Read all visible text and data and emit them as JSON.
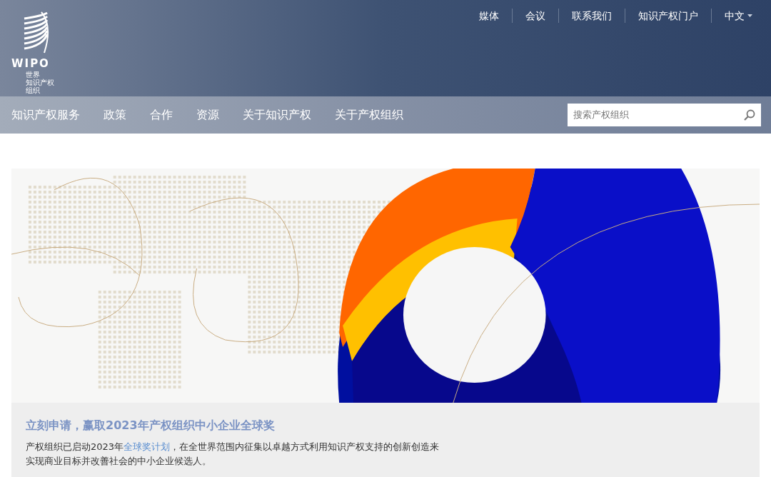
{
  "logo": {
    "wordmark": "WIPO",
    "lines": [
      "世界",
      "知识产权",
      "组织"
    ]
  },
  "top_links": [
    {
      "label": "媒体",
      "kind": "link"
    },
    {
      "label": "会议",
      "kind": "link"
    },
    {
      "label": "联系我们",
      "kind": "link"
    },
    {
      "label": "知识产权门户",
      "kind": "link"
    },
    {
      "label": "中文",
      "kind": "dropdown"
    }
  ],
  "nav": [
    "知识产权服务",
    "政策",
    "合作",
    "资源",
    "关于知识产权",
    "关于产权组织"
  ],
  "search": {
    "placeholder": "搜索产权组织"
  },
  "feature": {
    "title": "立刻申请，赢取2023年产权组织中小企业全球奖",
    "text_before": "产权组织已启动2023年",
    "link": "全球奖计划",
    "text_after": "，在全世界范围内征集以卓越方式利用知识产权支持的创新创造来实现商业目标并改善社会的中小企业候选人。"
  }
}
